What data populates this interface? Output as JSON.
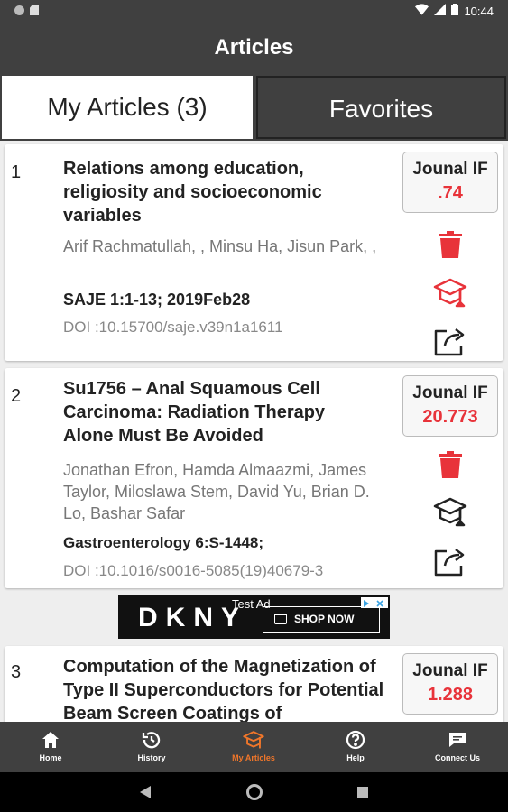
{
  "status_bar": {
    "time": "10:44"
  },
  "app_bar": {
    "title": "Articles"
  },
  "tabs": [
    {
      "label": "My Articles (3)",
      "active": true
    },
    {
      "label": "Favorites",
      "active": false
    }
  ],
  "articles": [
    {
      "num": "1",
      "title": "Relations among education, religiosity and socioeconomic variables",
      "authors": "Arif Rachmatullah,  , Minsu Ha, Jisun Park,  ,",
      "journal": "SAJE 1:1-13; 2019Feb28",
      "doi": "DOI :10.15700/saje.v39n1a1611",
      "if_label": "Jounal IF",
      "if_value": ".74",
      "cap_icon_color": "#e8333a"
    },
    {
      "num": "2",
      "title": "Su1756 – Anal Squamous Cell Carcinoma: Radiation Therapy Alone Must Be Avoided",
      "authors": "Jonathan Efron, Hamda Almaazmi, James Taylor, Miloslawa Stem, David Yu, Brian D. Lo, Bashar Safar",
      "journal": "Gastroenterology 6:S-1448;",
      "doi": "DOI :10.1016/s0016-5085(19)40679-3",
      "if_label": "Jounal IF",
      "if_value": "20.773",
      "cap_icon_color": "#222222"
    },
    {
      "num": "3",
      "title": "Computation of the Magnetization of Type II Superconductors for Potential Beam Screen Coatings of",
      "if_label": "Jounal IF",
      "if_value": "1.288"
    }
  ],
  "ad": {
    "brand": "DKNY",
    "tag": "Test Ad",
    "cta": "SHOP NOW"
  },
  "bottom_nav": [
    {
      "label": "Home",
      "icon": "home-icon",
      "active": false
    },
    {
      "label": "History",
      "icon": "history-icon",
      "active": false
    },
    {
      "label": "My Articles",
      "icon": "my-articles-icon",
      "active": true
    },
    {
      "label": "Help",
      "icon": "help-icon",
      "active": false
    },
    {
      "label": "Connect Us",
      "icon": "connect-icon",
      "active": false
    }
  ],
  "colors": {
    "bar": "#404040",
    "accent_red": "#e8333a",
    "nav_active": "#f0762a"
  }
}
